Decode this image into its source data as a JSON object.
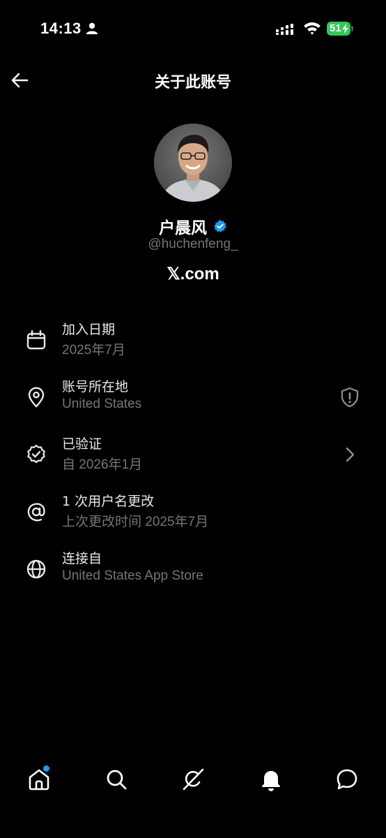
{
  "status_bar": {
    "time": "14:13",
    "battery": "51"
  },
  "header": {
    "title": "关于此账号"
  },
  "profile": {
    "name": "户晨风",
    "handle": "@huchenfeng_",
    "site": "𝕏.com"
  },
  "rows": [
    {
      "icon": "calendar-icon",
      "title": "加入日期",
      "subtitle": "2025年7月"
    },
    {
      "icon": "location-pin-icon",
      "title": "账号所在地",
      "subtitle": "United States",
      "right_icon": "shield-alert-icon"
    },
    {
      "icon": "verified-badge-icon",
      "title": "已验证",
      "subtitle": "自 2026年1月",
      "right_icon": "chevron-right-icon"
    },
    {
      "icon": "at-sign-icon",
      "title": "1 次用户名更改",
      "subtitle": "上次更改时间 2025年7月"
    },
    {
      "icon": "globe-icon",
      "title": "连接自",
      "subtitle": "United States App Store"
    }
  ],
  "nav": [
    "home-icon",
    "search-icon",
    "grok-icon",
    "notifications-icon",
    "messages-icon"
  ],
  "colors": {
    "background": "#000000",
    "text": "#e7e9ea",
    "secondary": "#71767b",
    "accent": "#1d9bf0",
    "battery": "#34c759"
  }
}
